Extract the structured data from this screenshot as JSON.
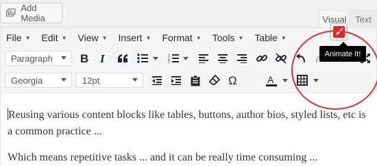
{
  "media": {
    "add_media_label": "Add Media",
    "icon": "media-icon"
  },
  "tabs": [
    {
      "label": "Visual",
      "active": true
    },
    {
      "label": "Text",
      "active": false
    }
  ],
  "menubar": [
    {
      "label": "File"
    },
    {
      "label": "Edit"
    },
    {
      "label": "View"
    },
    {
      "label": "Insert"
    },
    {
      "label": "Format"
    },
    {
      "label": "Tools"
    },
    {
      "label": "Table"
    }
  ],
  "toolbar1": {
    "format_select": "Paragraph",
    "buttons": [
      "bold-icon",
      "italic-icon",
      "blockquote-icon",
      "bullet-list-icon",
      "numbered-list-icon",
      "align-left-icon",
      "align-center-icon",
      "align-right-icon",
      "link-icon",
      "unlink-icon",
      "undo-icon",
      "redo-icon",
      "animate-it-icon",
      "fullscreen-icon"
    ]
  },
  "toolbar2": {
    "font_select": "Georgia",
    "size_select": "12pt",
    "buttons": [
      "outdent-icon",
      "indent-icon",
      "paste-text-icon",
      "clear-formatting-icon",
      "special-character-icon",
      "text-color-icon",
      "table-icon"
    ]
  },
  "tooltip": {
    "text": "Animate It!"
  },
  "colors": {
    "highlight_circle": "#d9333a",
    "animate_icon": "#e0262c",
    "text_color_bar": "#1e1e1e"
  },
  "content": {
    "paragraphs": [
      "Reusing various content blocks like tables, buttons, author bios, styled lists, etc is a common practice ...",
      "Which means repetitive tasks ... and it can be really time consuming ..."
    ]
  }
}
